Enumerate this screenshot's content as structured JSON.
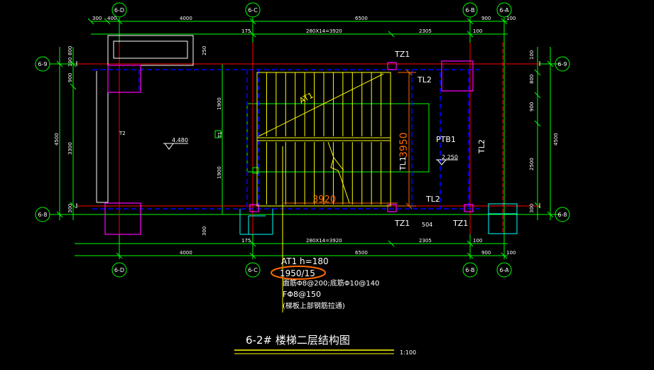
{
  "axes": {
    "top": [
      {
        "key": "d",
        "label": "6-D"
      },
      {
        "key": "c",
        "label": "6-C"
      },
      {
        "key": "b",
        "label": "6-B"
      },
      {
        "key": "a",
        "label": "6-A"
      }
    ],
    "bottom": [
      {
        "key": "d",
        "label": "6-D"
      },
      {
        "key": "c",
        "label": "6-C"
      },
      {
        "key": "b",
        "label": "6-B"
      },
      {
        "key": "a",
        "label": "6-A"
      }
    ],
    "left": [
      {
        "key": "9",
        "label": "6-9"
      },
      {
        "key": "8",
        "label": "6-8"
      }
    ],
    "right": [
      {
        "key": "9",
        "label": "6-9"
      },
      {
        "key": "8",
        "label": "6-8"
      }
    ]
  },
  "dimensions": {
    "top_row1": [
      "300",
      "400",
      "4000",
      "6500",
      "900",
      "100"
    ],
    "top_row2": [
      "175",
      "280X14=3920",
      "2305",
      "100"
    ],
    "bottom_row1": [
      "175",
      "280X14=3920",
      "2305",
      "100"
    ],
    "bottom_row2": [
      "4000",
      "6500",
      "900",
      "100"
    ],
    "left_outer": "4500",
    "left_inner": [
      "800",
      "100",
      "900",
      "3300",
      "300"
    ],
    "right_outer": "4500",
    "right_inner": [
      "100",
      "800",
      "900",
      "2500",
      "300"
    ],
    "mid_vertical": [
      "1900",
      "1900"
    ],
    "small_labels": [
      "250",
      "300",
      "504"
    ]
  },
  "labels": {
    "tz1_top": "TZ1",
    "tl2_top": "TL2",
    "at1": "AT1",
    "tl1": "TL1",
    "tl1_value": "3950",
    "ptb1": "PTB1",
    "elev_ptb1": "2.250",
    "elev_left": "4.480",
    "tl2_right": "TL2",
    "tl2_bottom": "TL2",
    "flight_length": "3920",
    "tz1_bottom_left": "TZ1",
    "tz1_bottom_right": "TZ1",
    "t2": "T2",
    "t1": "T1"
  },
  "note": {
    "line1": "AT1 h=180",
    "line2": "1950/15",
    "line3": "面筋Φ8@200;底筋Φ10@140",
    "line4": "FΦ8@150",
    "line5": "(梯板上部钢筋拉通)"
  },
  "title": {
    "text": "6-2# 楼梯二层结构图",
    "scale": "1:100"
  },
  "colors": {
    "axis": "#00ff00",
    "dashed_beam": "#0000ff",
    "red_line": "#ff0000",
    "column": "#ff00ff",
    "stair": "#ffff00",
    "annotation": "#ff6a00",
    "wall": "#ffffff",
    "cyan": "#00ffff"
  }
}
